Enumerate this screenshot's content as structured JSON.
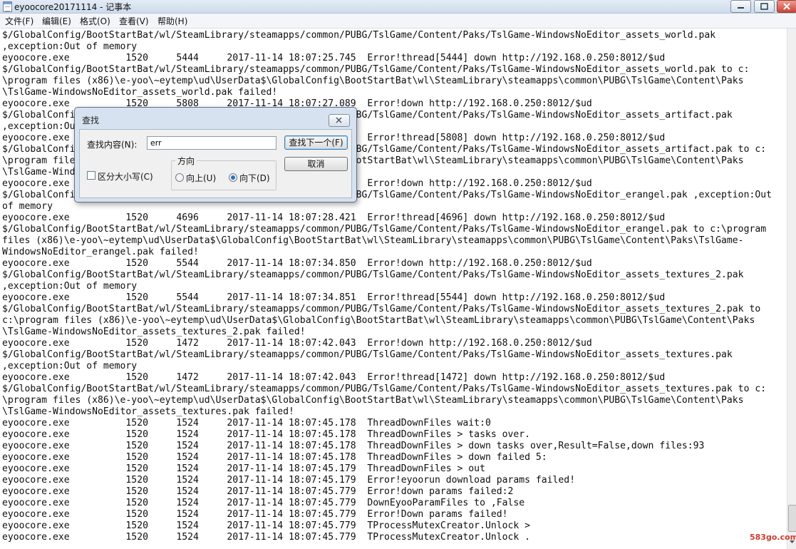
{
  "window": {
    "title": "eyoocore20171114 - 记事本",
    "menu": [
      "文件(F)",
      "编辑(E)",
      "格式(O)",
      "查看(V)",
      "帮助(H)"
    ]
  },
  "editor_lines": [
    "$/GlobalConfig/BootStartBat/wl/SteamLibrary/steamapps/common/PUBG/TslGame/Content/Paks/TslGame-WindowsNoEditor_assets_world.pak",
    ",exception:Out of memory",
    "eyoocore.exe          1520     5444     2017-11-14 18:07:25.745  Error!thread[5444] down http://192.168.0.250:8012/$ud",
    "$/GlobalConfig/BootStartBat/wl/SteamLibrary/steamapps/common/PUBG/TslGame/Content/Paks/TslGame-WindowsNoEditor_assets_world.pak to c:",
    "\\program files (x86)\\e-yoo\\~eytemp\\ud\\UserData$\\GlobalConfig\\BootStartBat\\wl\\SteamLibrary\\steamapps\\common\\PUBG\\TslGame\\Content\\Paks",
    "\\TslGame-WindowsNoEditor_assets_world.pak failed!",
    "eyoocore.exe          1520     5808     2017-11-14 18:07:27.089  Error!down http://192.168.0.250:8012/$ud",
    "$/GlobalConfig/BootStartBat/wl/SteamLibrary/steamapps/common/PUBG/TslGame/Content/Paks/TslGame-WindowsNoEditor_assets_artifact.pak",
    ",exception:Out of memory",
    "eyoocore.exe          1520     5808     2017-11-14 18:07:27.092  Error!thread[5808] down http://192.168.0.250:8012/$ud",
    "$/GlobalConfig/BootStartBat/wl/SteamLibrary/steamapps/common/PUBG/TslGame/Content/Paks/TslGame-WindowsNoEditor_assets_artifact.pak to c:",
    "\\program files (x86)\\e-yoo\\~eytemp\\ud\\UserData$\\GlobalConfig\\BootStartBat\\wl\\SteamLibrary\\steamapps\\common\\PUBG\\TslGame\\Content\\Paks",
    "\\TslGame-WindowsNoEditor_assets_artifact.pak failed!",
    "eyoocore.exe          1520     4696     2017-11-14 18:07:28.420  Error!down http://192.168.0.250:8012/$ud",
    "$/GlobalConfig/BootStartBat/wl/SteamLibrary/steamapps/common/PUBG/TslGame/Content/Paks/TslGame-WindowsNoEditor_erangel.pak ,exception:Out",
    "of memory",
    "eyoocore.exe          1520     4696     2017-11-14 18:07:28.421  Error!thread[4696] down http://192.168.0.250:8012/$ud",
    "$/GlobalConfig/BootStartBat/wl/SteamLibrary/steamapps/common/PUBG/TslGame/Content/Paks/TslGame-WindowsNoEditor_erangel.pak to c:\\program",
    "files (x86)\\e-yoo\\~eytemp\\ud\\UserData$\\GlobalConfig\\BootStartBat\\wl\\SteamLibrary\\steamapps\\common\\PUBG\\TslGame\\Content\\Paks\\TslGame-",
    "WindowsNoEditor_erangel.pak failed!",
    "eyoocore.exe          1520     5544     2017-11-14 18:07:34.850  Error!down http://192.168.0.250:8012/$ud",
    "$/GlobalConfig/BootStartBat/wl/SteamLibrary/steamapps/common/PUBG/TslGame/Content/Paks/TslGame-WindowsNoEditor_assets_textures_2.pak",
    ",exception:Out of memory",
    "eyoocore.exe          1520     5544     2017-11-14 18:07:34.851  Error!thread[5544] down http://192.168.0.250:8012/$ud",
    "$/GlobalConfig/BootStartBat/wl/SteamLibrary/steamapps/common/PUBG/TslGame/Content/Paks/TslGame-WindowsNoEditor_assets_textures_2.pak to",
    "c:\\program files (x86)\\e-yoo\\~eytemp\\ud\\UserData$\\GlobalConfig\\BootStartBat\\wl\\SteamLibrary\\steamapps\\common\\PUBG\\TslGame\\Content\\Paks",
    "\\TslGame-WindowsNoEditor_assets_textures_2.pak failed!",
    "eyoocore.exe          1520     1472     2017-11-14 18:07:42.043  Error!down http://192.168.0.250:8012/$ud",
    "$/GlobalConfig/BootStartBat/wl/SteamLibrary/steamapps/common/PUBG/TslGame/Content/Paks/TslGame-WindowsNoEditor_assets_textures.pak",
    ",exception:Out of memory",
    "eyoocore.exe          1520     1472     2017-11-14 18:07:42.043  Error!thread[1472] down http://192.168.0.250:8012/$ud",
    "$/GlobalConfig/BootStartBat/wl/SteamLibrary/steamapps/common/PUBG/TslGame/Content/Paks/TslGame-WindowsNoEditor_assets_textures.pak to c:",
    "\\program files (x86)\\e-yoo\\~eytemp\\ud\\UserData$\\GlobalConfig\\BootStartBat\\wl\\SteamLibrary\\steamapps\\common\\PUBG\\TslGame\\Content\\Paks",
    "\\TslGame-WindowsNoEditor_assets_textures.pak failed!",
    "eyoocore.exe          1520     1524     2017-11-14 18:07:45.178  ThreadDownFiles wait:0",
    "eyoocore.exe          1520     1524     2017-11-14 18:07:45.178  ThreadDownFiles > tasks over.",
    "eyoocore.exe          1520     1524     2017-11-14 18:07:45.178  ThreadDownFiles > down tasks over,Result=False,down files:93",
    "eyoocore.exe          1520     1524     2017-11-14 18:07:45.178  ThreadDownFiles > down failed 5:",
    "eyoocore.exe          1520     1524     2017-11-14 18:07:45.179  ThreadDownFiles > out",
    "eyoocore.exe          1520     1524     2017-11-14 18:07:45.179  Error!eyoorun download params failed!",
    "eyoocore.exe          1520     1524     2017-11-14 18:07:45.779  Error!down params failed:2",
    "eyoocore.exe          1520     1524     2017-11-14 18:07:45.779  DownEyooParamFiles to ,False",
    "eyoocore.exe          1520     1524     2017-11-14 18:07:45.779  Error!Down params failed!",
    "eyoocore.exe          1520     1524     2017-11-14 18:07:45.779  TProcessMutexCreator.Unlock >",
    "eyoocore.exe          1520     1524     2017-11-14 18:07:45.779  TProcessMutexCreator.Unlock ."
  ],
  "find_dialog": {
    "title": "查找",
    "find_label": "查找内容(N):",
    "find_value": "err",
    "find_next_label": "查找下一个(F)",
    "cancel_label": "取消",
    "direction_label": "方向",
    "up_label": "向上(U)",
    "down_label": "向下(D)",
    "direction_selected": "down",
    "match_case_label": "区分大小写(C)",
    "match_case_checked": false
  },
  "watermark": "583go.com",
  "colors": {
    "titlebar": "#cddbeb",
    "dialog_frame": "#d6e2f0",
    "close_button": "#c9453a",
    "watermark": "#d13b2f"
  }
}
